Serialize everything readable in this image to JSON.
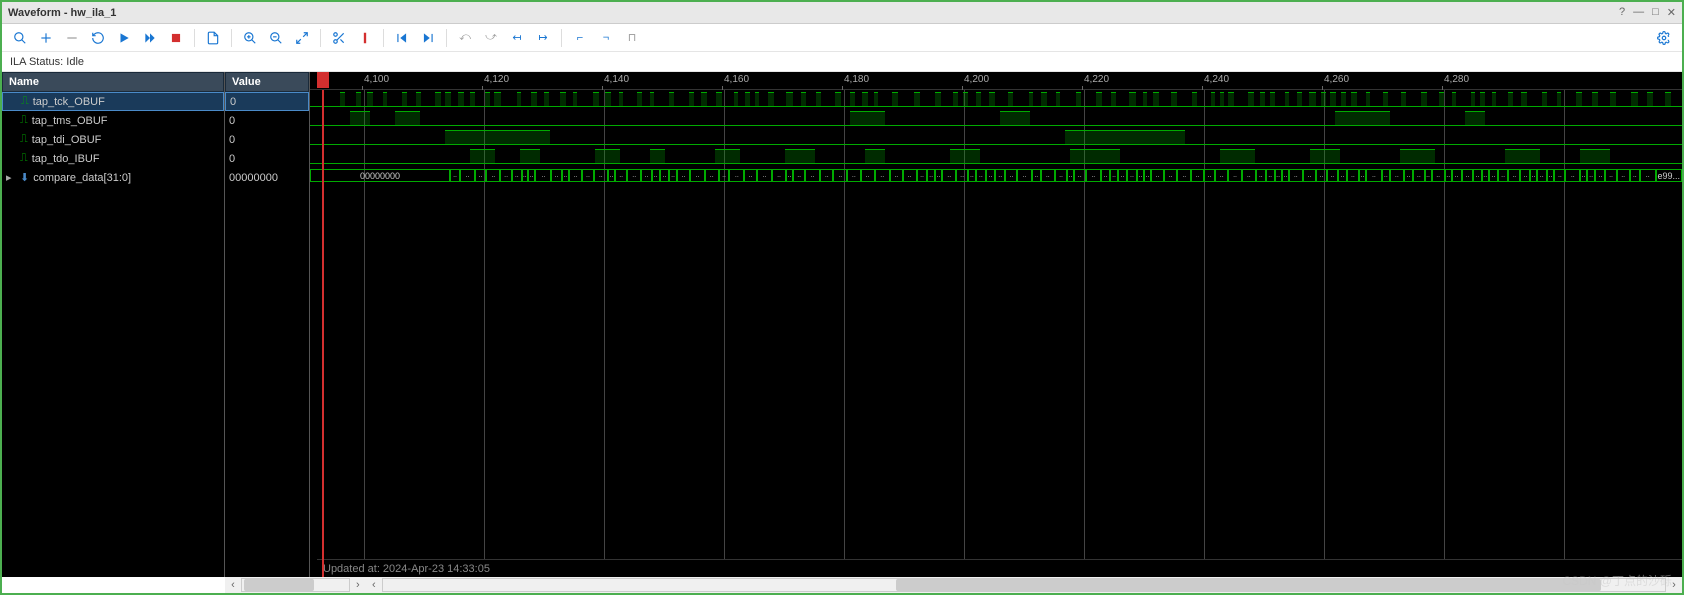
{
  "window": {
    "title": "Waveform - hw_ila_1"
  },
  "status": {
    "label": "ILA Status:",
    "value": "Idle"
  },
  "headers": {
    "name": "Name",
    "value": "Value"
  },
  "signals": [
    {
      "name": "tap_tck_OBUF",
      "value": "0",
      "type": "wire"
    },
    {
      "name": "tap_tms_OBUF",
      "value": "0",
      "type": "wire"
    },
    {
      "name": "tap_tdi_OBUF",
      "value": "0",
      "type": "wire"
    },
    {
      "name": "tap_tdo_IBUF",
      "value": "0",
      "type": "wire"
    },
    {
      "name": "compare_data[31:0]",
      "value": "00000000",
      "type": "bus",
      "expandable": true
    }
  ],
  "ruler": {
    "ticks": [
      "4,100",
      "4,120",
      "4,140",
      "4,160",
      "4,180",
      "4,200",
      "4,220",
      "4,240",
      "4,260",
      "4,280"
    ],
    "start": 4091,
    "step": 20,
    "pxPerUnit": 6.0
  },
  "cursor": {
    "pos": 4093
  },
  "bus": {
    "first_label": "00000000",
    "last_label": "e99..."
  },
  "footer": {
    "text": "Updated at: 2024-Apr-23 14:33:05"
  },
  "watermark": "CSDN @丁点的沙砾"
}
